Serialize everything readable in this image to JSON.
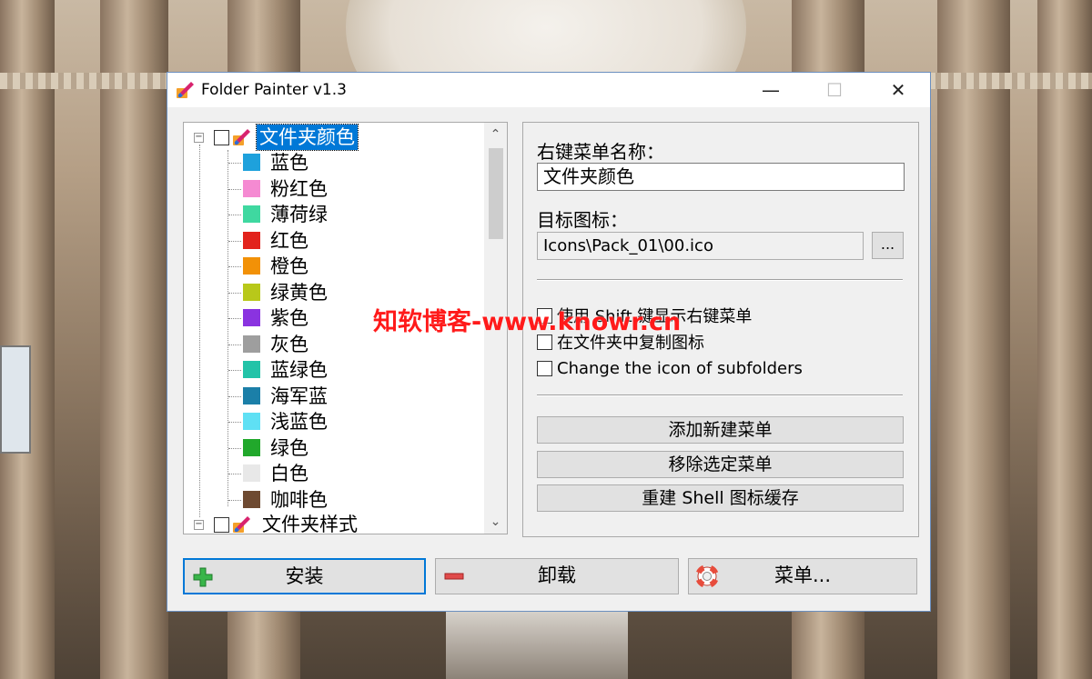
{
  "window": {
    "title": "Folder Painter v1.3",
    "minimize_glyph": "—",
    "maximize_glyph": "☐",
    "close_glyph": "✕"
  },
  "tree": {
    "root": {
      "label": "文件夹颜色",
      "expanded": true,
      "checked": false,
      "selected": true,
      "icon": "brush-icon"
    },
    "children": [
      {
        "label": "蓝色",
        "color": "#1ea1dc"
      },
      {
        "label": "粉红色",
        "color": "#f58ad2"
      },
      {
        "label": "薄荷绿",
        "color": "#3fd8a0"
      },
      {
        "label": "红色",
        "color": "#e2231c"
      },
      {
        "label": "橙色",
        "color": "#f29107"
      },
      {
        "label": "绿黄色",
        "color": "#b8c81a"
      },
      {
        "label": "紫色",
        "color": "#8a33e0"
      },
      {
        "label": "灰色",
        "color": "#9e9e9e"
      },
      {
        "label": "蓝绿色",
        "color": "#22c3a8"
      },
      {
        "label": "海军蓝",
        "color": "#1b7fa8"
      },
      {
        "label": "浅蓝色",
        "color": "#5fe0f4"
      },
      {
        "label": "绿色",
        "color": "#21a82b"
      },
      {
        "label": "白色",
        "color": "#e8e8e8"
      },
      {
        "label": "咖啡色",
        "color": "#6e4a31"
      }
    ],
    "second_root": {
      "label": "文件夹样式",
      "expanded": true,
      "checked": false,
      "icon": "brush-icon"
    },
    "scroll_up": "⌃",
    "scroll_down": "⌄"
  },
  "settings": {
    "menu_name_label": "右键菜单名称：",
    "menu_name_value": "文件夹颜色",
    "target_icon_label": "目标图标：",
    "target_icon_value": "Icons\\Pack_01\\00.ico",
    "browse_label": "...",
    "options": [
      {
        "label": "使用 Shift 键显示右键菜单",
        "checked": false
      },
      {
        "label": "在文件夹中复制图标",
        "checked": false
      },
      {
        "label": "Change the icon of subfolders",
        "checked": false
      }
    ],
    "add_menu": "添加新建菜单",
    "remove_menu": "移除选定菜单",
    "rebuild_cache": "重建 Shell 图标缓存"
  },
  "actions": {
    "install": "安装",
    "uninstall": "卸载",
    "menu": "菜单..."
  },
  "watermark": "知软博客-www.knowr.cn",
  "colors": {
    "accent": "#0078d7",
    "watermark": "#ff1a1a"
  }
}
